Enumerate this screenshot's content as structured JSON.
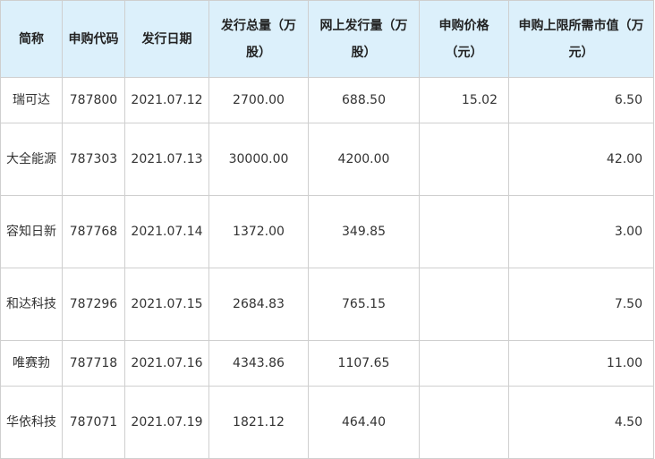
{
  "table": {
    "headers": [
      "简称",
      "申购代码",
      "发行日期",
      "发行总量（万股）",
      "网上发行量（万股）",
      "申购价格（元）",
      "申购上限所需市值（万元）"
    ],
    "rows": [
      {
        "name": "瑞可达",
        "code": "787800",
        "date": "2021.07.12",
        "total": "2700.00",
        "online": "688.50",
        "price": "15.02",
        "cap": "6.50"
      },
      {
        "name": "大全能源",
        "code": "787303",
        "date": "2021.07.13",
        "total": "30000.00",
        "online": "4200.00",
        "price": "",
        "cap": "42.00"
      },
      {
        "name": "容知日新",
        "code": "787768",
        "date": "2021.07.14",
        "total": "1372.00",
        "online": "349.85",
        "price": "",
        "cap": "3.00"
      },
      {
        "name": "和达科技",
        "code": "787296",
        "date": "2021.07.15",
        "total": "2684.83",
        "online": "765.15",
        "price": "",
        "cap": "7.50"
      },
      {
        "name": "唯赛勃",
        "code": "787718",
        "date": "2021.07.16",
        "total": "4343.86",
        "online": "1107.65",
        "price": "",
        "cap": "11.00"
      },
      {
        "name": "华依科技",
        "code": "787071",
        "date": "2021.07.19",
        "total": "1821.12",
        "online": "464.40",
        "price": "",
        "cap": "4.50"
      }
    ]
  }
}
